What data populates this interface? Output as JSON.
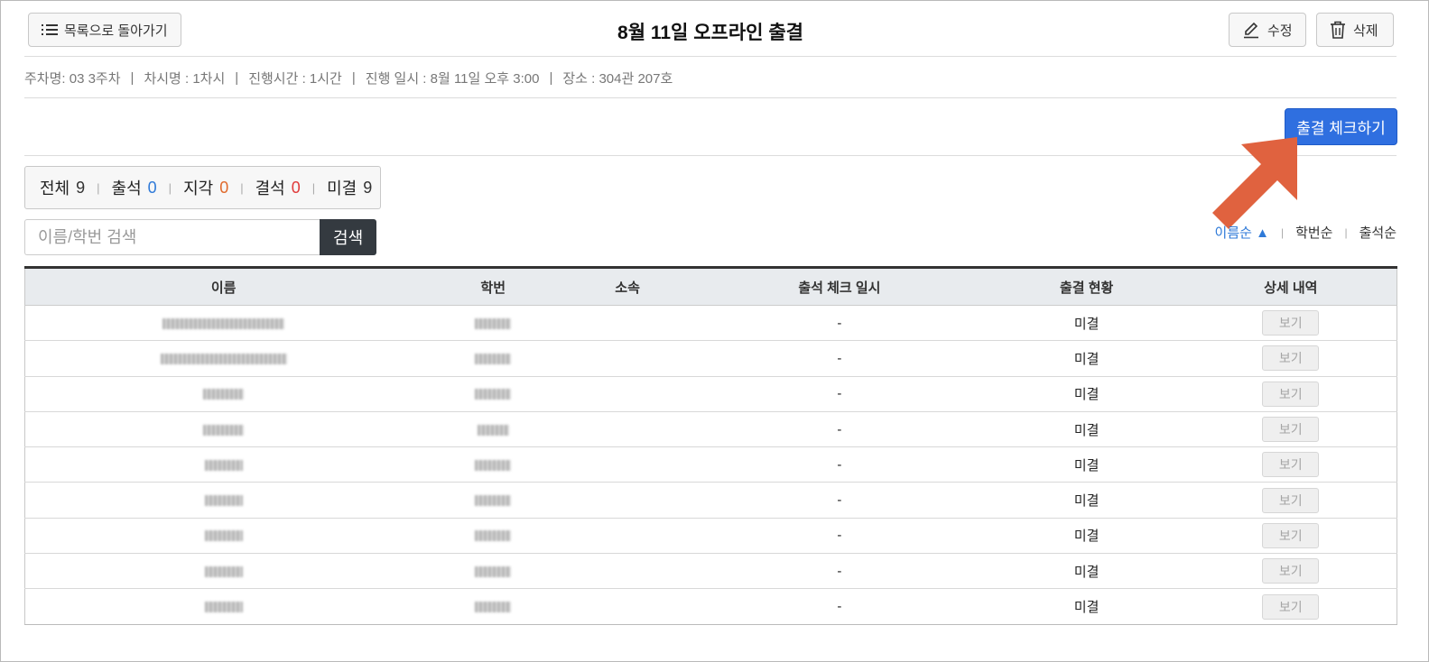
{
  "header": {
    "back_label": "목록으로 돌아가기",
    "title": "8월 11일 오프라인 출결",
    "edit_label": "수정",
    "delete_label": "삭제"
  },
  "meta": {
    "week": "주차명: 03 3주차",
    "session": "차시명 : 1차시",
    "duration": "진행시간 : 1시간",
    "datetime": "진행 일시 : 8월 11일 오후 3:00",
    "location": "장소 : 304관 207호"
  },
  "check_button": "출결 체크하기",
  "stats": {
    "total_label": "전체",
    "total": "9",
    "present_label": "출석",
    "present": "0",
    "late_label": "지각",
    "late": "0",
    "absent_label": "결석",
    "absent": "0",
    "unchecked_label": "미결",
    "unchecked": "9"
  },
  "search": {
    "placeholder": "이름/학번 검색",
    "button": "검색"
  },
  "sort": {
    "by_name": "이름순 ▲",
    "by_id": "학번순",
    "by_attendance": "출석순"
  },
  "table": {
    "columns": [
      "이름",
      "학번",
      "소속",
      "출석 체크 일시",
      "출결 현황",
      "상세 내역"
    ],
    "rows": [
      {
        "checked_at": "-",
        "status": "미결",
        "action": "보기"
      },
      {
        "checked_at": "-",
        "status": "미결",
        "action": "보기"
      },
      {
        "checked_at": "-",
        "status": "미결",
        "action": "보기"
      },
      {
        "checked_at": "-",
        "status": "미결",
        "action": "보기"
      },
      {
        "checked_at": "-",
        "status": "미결",
        "action": "보기"
      },
      {
        "checked_at": "-",
        "status": "미결",
        "action": "보기"
      },
      {
        "checked_at": "-",
        "status": "미결",
        "action": "보기"
      },
      {
        "checked_at": "-",
        "status": "미결",
        "action": "보기"
      },
      {
        "checked_at": "-",
        "status": "미결",
        "action": "보기"
      }
    ]
  },
  "colors": {
    "primary": "#2f6fe0",
    "present": "#2f7ad8",
    "late": "#e06a2c",
    "absent": "#e03a3a",
    "annotation_arrow": "#e0623f"
  },
  "icons": [
    "list-icon",
    "pencil-icon",
    "trash-icon"
  ]
}
